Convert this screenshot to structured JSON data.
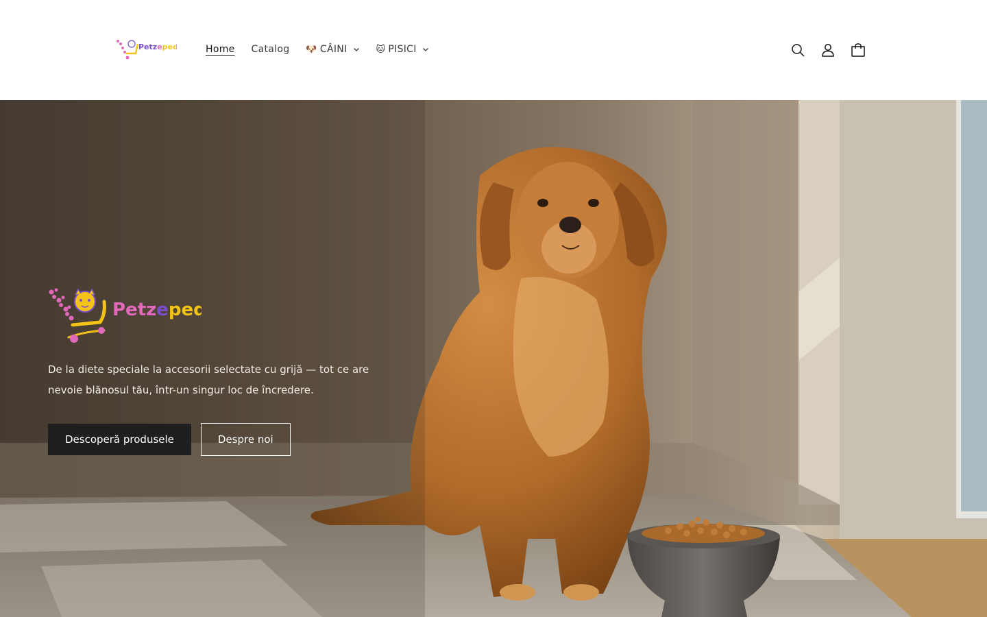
{
  "brand": {
    "name": "Petzepedia",
    "name_parts": [
      "Petz",
      "e",
      "pedia"
    ],
    "colors": {
      "pink": "#e06ab9",
      "yellow": "#f3c318",
      "purple": "#7b4fc9"
    }
  },
  "nav": {
    "items": [
      {
        "label": "Home",
        "emoji": "",
        "dropdown": false,
        "active": true
      },
      {
        "label": "Catalog",
        "emoji": "",
        "dropdown": false,
        "active": false
      },
      {
        "label": "CÂINI",
        "emoji": "🐶",
        "dropdown": true,
        "active": false
      },
      {
        "label": "PISICI",
        "emoji": "🐱",
        "dropdown": true,
        "active": false
      }
    ]
  },
  "header_icons": [
    "search-icon",
    "account-icon",
    "cart-icon"
  ],
  "hero": {
    "text": "De la diete speciale la accesorii selectate cu grijă — tot ce are nevoie blănosul tău, într-un singur loc de încredere.",
    "primary_button": "Descoperă produsele",
    "secondary_button": "Despre noi",
    "image": "golden-retriever-sitting-next-to-food-bowl"
  },
  "colors": {
    "button_dark": "#1e1e1e",
    "header_bg": "#ffffff",
    "text_dark": "#121212"
  }
}
